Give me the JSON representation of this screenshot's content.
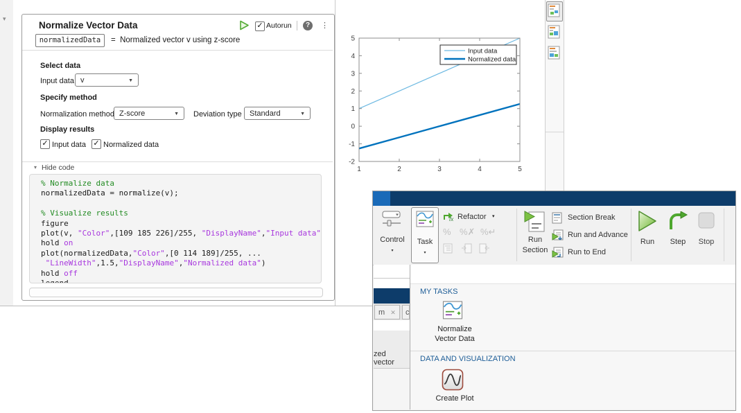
{
  "task_panel": {
    "title": "Normalize Vector Data",
    "autorun_label": "Autorun",
    "output_var": "normalizedData",
    "equals": "=",
    "summary": "Normalized vector v using z-score",
    "select_data_heading": "Select data",
    "input_data_label": "Input data",
    "input_data_value": "v",
    "specify_method_heading": "Specify method",
    "normalization_method_label": "Normalization method",
    "normalization_method_value": "Z-score",
    "deviation_type_label": "Deviation type",
    "deviation_type_value": "Standard",
    "display_results_heading": "Display results",
    "checkbox_input_label": "Input data",
    "checkbox_normalized_label": "Normalized data",
    "checkbox_glyph": "✓",
    "hide_code_label": "Hide code",
    "collapse_glyph": "▾",
    "kebab_glyph": "⋮",
    "help_glyph": "?"
  },
  "code_lines": [
    [
      {
        "t": "% Normalize data",
        "c": "comment"
      }
    ],
    [
      {
        "t": "normalizedData = normalize(v);",
        "c": "plain"
      }
    ],
    [],
    [
      {
        "t": "% Visualize results",
        "c": "comment"
      }
    ],
    [
      {
        "t": "figure",
        "c": "plain"
      }
    ],
    [
      {
        "t": "plot(v, ",
        "c": "plain"
      },
      {
        "t": "\"Color\"",
        "c": "string"
      },
      {
        "t": ",[109 185 226]/255, ",
        "c": "plain"
      },
      {
        "t": "\"DisplayName\"",
        "c": "string"
      },
      {
        "t": ",",
        "c": "plain"
      },
      {
        "t": "\"Input data\"",
        "c": "string"
      },
      {
        "t": ")",
        "c": "plain"
      }
    ],
    [
      {
        "t": "hold ",
        "c": "plain"
      },
      {
        "t": "on",
        "c": "string"
      }
    ],
    [
      {
        "t": "plot(normalizedData,",
        "c": "plain"
      },
      {
        "t": "\"Color\"",
        "c": "string"
      },
      {
        "t": ",[0 114 189]/255, ...",
        "c": "plain"
      }
    ],
    [
      {
        "t": " ",
        "c": "plain"
      },
      {
        "t": "\"LineWidth\"",
        "c": "string"
      },
      {
        "t": ",1.5,",
        "c": "plain"
      },
      {
        "t": "\"DisplayName\"",
        "c": "string"
      },
      {
        "t": ",",
        "c": "plain"
      },
      {
        "t": "\"Normalized data\"",
        "c": "string"
      },
      {
        "t": ")",
        "c": "plain"
      }
    ],
    [
      {
        "t": "hold ",
        "c": "plain"
      },
      {
        "t": "off",
        "c": "string"
      }
    ],
    [
      {
        "t": "legend",
        "c": "plain"
      }
    ]
  ],
  "chart_data": {
    "type": "line",
    "title": "",
    "xlabel": "",
    "ylabel": "",
    "x": [
      1,
      2,
      3,
      4,
      5
    ],
    "series": [
      {
        "name": "Input data",
        "values": [
          1,
          2,
          3,
          4,
          5
        ],
        "color": "#6db9e2",
        "width": 1.2
      },
      {
        "name": "Normalized data",
        "values": [
          -1.2649,
          -0.6325,
          0,
          0.6325,
          1.2649
        ],
        "color": "#0072bd",
        "width": 2.4
      }
    ],
    "xlim": [
      1,
      5
    ],
    "ylim": [
      -2,
      5
    ],
    "xticks": [
      1,
      2,
      3,
      4,
      5
    ],
    "yticks": [
      -2,
      -1,
      0,
      1,
      2,
      3,
      4,
      5
    ],
    "grid": false,
    "legend_position": "northeast"
  },
  "toolstrip": {
    "control_label": "Control",
    "task_label": "Task",
    "refactor_label": "Refactor",
    "run_section_line1": "Run",
    "run_section_line2": "Section",
    "section_break_label": "Section Break",
    "run_and_advance_label": "Run and Advance",
    "run_to_end_label": "Run to End",
    "run_label": "Run",
    "step_label": "Step",
    "stop_label": "Stop",
    "caret_glyph": "▾",
    "percent_glyph": "%"
  },
  "task_gallery": {
    "my_tasks_heading": "MY TASKS",
    "item1_line1": "Normalize",
    "item1_line2": "Vector Data",
    "data_viz_heading": "DATA AND VISUALIZATION",
    "item2_label": "Create Plot"
  },
  "editor_background": {
    "tab1_text": "m",
    "tab1_close_glyph": "✕",
    "tab2_text": "c",
    "partial_text": "zed vector"
  },
  "icons": {
    "run_task": "green-play-outline-icon",
    "autorun_checkbox": "checkbox-checked",
    "help": "question-circle-icon",
    "menu": "kebab-menu-icon",
    "control": "slider-control-icon",
    "task": "task-wave-document-icon",
    "refactor": "fx-green-arrow-icon",
    "comment_group": "percent-comment-icons",
    "run_section": "document-play-icon",
    "section_break": "document-split-icon",
    "run_and_advance": "document-play-advance-icon",
    "run_to_end": "document-play-end-icon",
    "run": "green-play-triangle-icon",
    "step": "green-step-arrow-icon",
    "stop": "gray-stop-square-icon",
    "output_view_1": "output-inline-view-icon",
    "output_view_2": "output-right-view-icon",
    "output_view_3": "output-split-view-icon",
    "create_plot": "sine-curve-icon"
  },
  "colors": {
    "titlebar_navy": "#0d3c6a",
    "titlebar_accent": "#1a6ab8",
    "run_green": "#5ba839",
    "input_line": "#6db9e2",
    "normalized_line": "#0072bd",
    "gallery_heading_blue": "#1d5d97",
    "comment_green": "#228B22",
    "string_purple": "#a837de"
  }
}
